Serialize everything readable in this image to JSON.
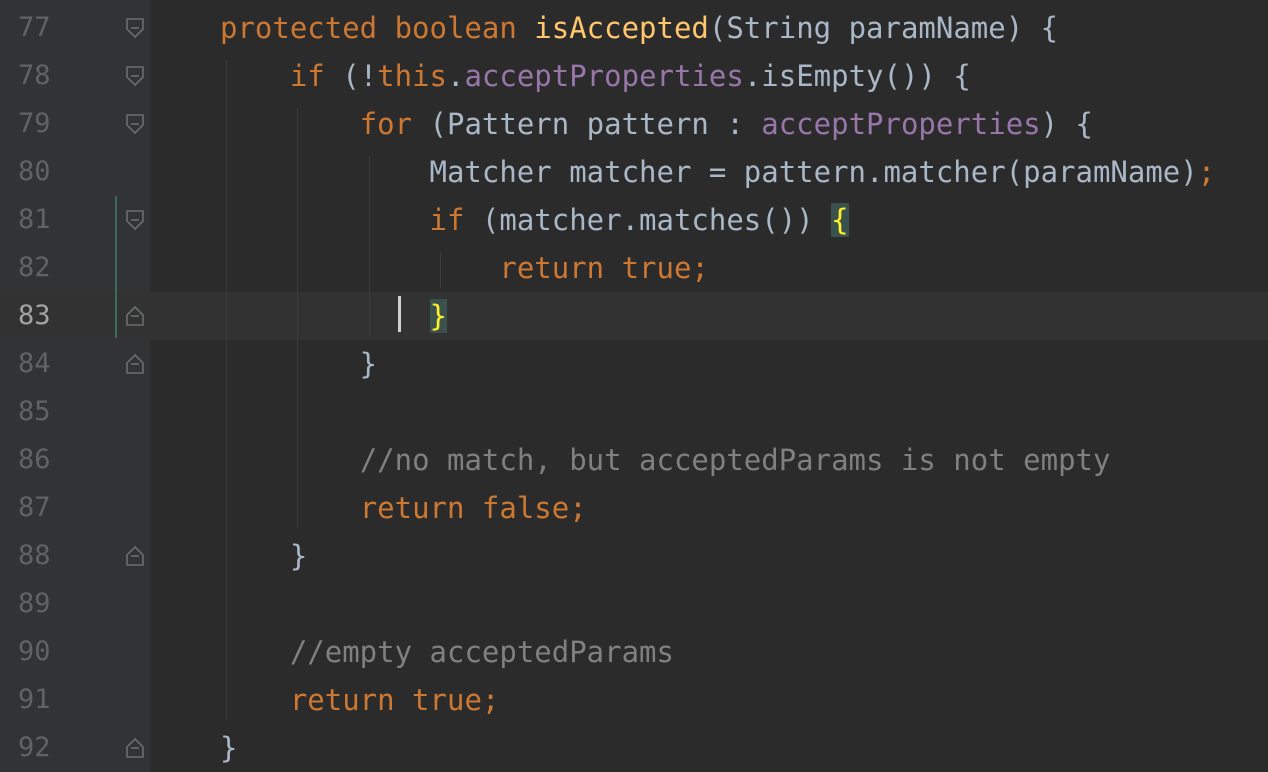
{
  "editor": {
    "colors": {
      "background": "#2b2b2b",
      "gutter": "#313335",
      "current_line": "#323232",
      "keyword": "#cc7832",
      "method_declaration": "#ffc66d",
      "field": "#9876aa",
      "comment": "#808080",
      "default_text": "#a9b7c6",
      "line_number": "#606366",
      "brace_match": "#ffef28",
      "change_marker": "#3d6a5c"
    },
    "lines": [
      {
        "number": "77",
        "fold": "fold-open-icon",
        "segments": [
          {
            "t": "protected boolean ",
            "c": "kw"
          },
          {
            "t": "isAccepted",
            "c": "fn"
          },
          {
            "t": "(String paramName) {",
            "c": ""
          }
        ]
      },
      {
        "number": "78",
        "fold": "fold-open-icon",
        "segments": [
          {
            "t": "    ",
            "c": ""
          },
          {
            "t": "if ",
            "c": "kw"
          },
          {
            "t": "(!",
            "c": ""
          },
          {
            "t": "this",
            "c": "kw"
          },
          {
            "t": ".",
            "c": ""
          },
          {
            "t": "acceptProperties",
            "c": "field"
          },
          {
            "t": ".isEmpty()) {",
            "c": ""
          }
        ]
      },
      {
        "number": "79",
        "fold": "fold-open-icon",
        "segments": [
          {
            "t": "        ",
            "c": ""
          },
          {
            "t": "for ",
            "c": "kw"
          },
          {
            "t": "(Pattern pattern : ",
            "c": ""
          },
          {
            "t": "acceptProperties",
            "c": "field"
          },
          {
            "t": ") {",
            "c": ""
          }
        ]
      },
      {
        "number": "80",
        "fold": "",
        "segments": [
          {
            "t": "            Matcher matcher = pattern.matcher(paramName)",
            "c": ""
          },
          {
            "t": ";",
            "c": "kw"
          }
        ]
      },
      {
        "number": "81",
        "fold": "fold-open-icon",
        "segments": [
          {
            "t": "            ",
            "c": ""
          },
          {
            "t": "if ",
            "c": "kw"
          },
          {
            "t": "(matcher.matches()) ",
            "c": ""
          },
          {
            "t": "{",
            "c": "brace-hl"
          }
        ]
      },
      {
        "number": "82",
        "fold": "",
        "segments": [
          {
            "t": "                ",
            "c": ""
          },
          {
            "t": "return true;",
            "c": "kw"
          }
        ]
      },
      {
        "number": "83",
        "fold": "fold-close-icon",
        "current": true,
        "segments": [
          {
            "t": "            ",
            "c": ""
          },
          {
            "t": "}",
            "c": "brace-hl"
          }
        ]
      },
      {
        "number": "84",
        "fold": "fold-close-icon",
        "segments": [
          {
            "t": "        }",
            "c": ""
          }
        ]
      },
      {
        "number": "85",
        "fold": "",
        "segments": []
      },
      {
        "number": "86",
        "fold": "",
        "segments": [
          {
            "t": "        ",
            "c": ""
          },
          {
            "t": "//no match, but acceptedParams is not empty",
            "c": "cmt"
          }
        ]
      },
      {
        "number": "87",
        "fold": "",
        "segments": [
          {
            "t": "        ",
            "c": ""
          },
          {
            "t": "return false;",
            "c": "kw"
          }
        ]
      },
      {
        "number": "88",
        "fold": "fold-close-icon",
        "segments": [
          {
            "t": "    }",
            "c": ""
          }
        ]
      },
      {
        "number": "89",
        "fold": "",
        "segments": []
      },
      {
        "number": "90",
        "fold": "",
        "segments": [
          {
            "t": "    ",
            "c": ""
          },
          {
            "t": "//empty acceptedParams",
            "c": "cmt"
          }
        ]
      },
      {
        "number": "91",
        "fold": "",
        "segments": [
          {
            "t": "    ",
            "c": ""
          },
          {
            "t": "return true;",
            "c": "kw"
          }
        ]
      },
      {
        "number": "92",
        "fold": "fold-close-icon",
        "segments": [
          {
            "t": "}",
            "c": ""
          }
        ]
      }
    ]
  }
}
